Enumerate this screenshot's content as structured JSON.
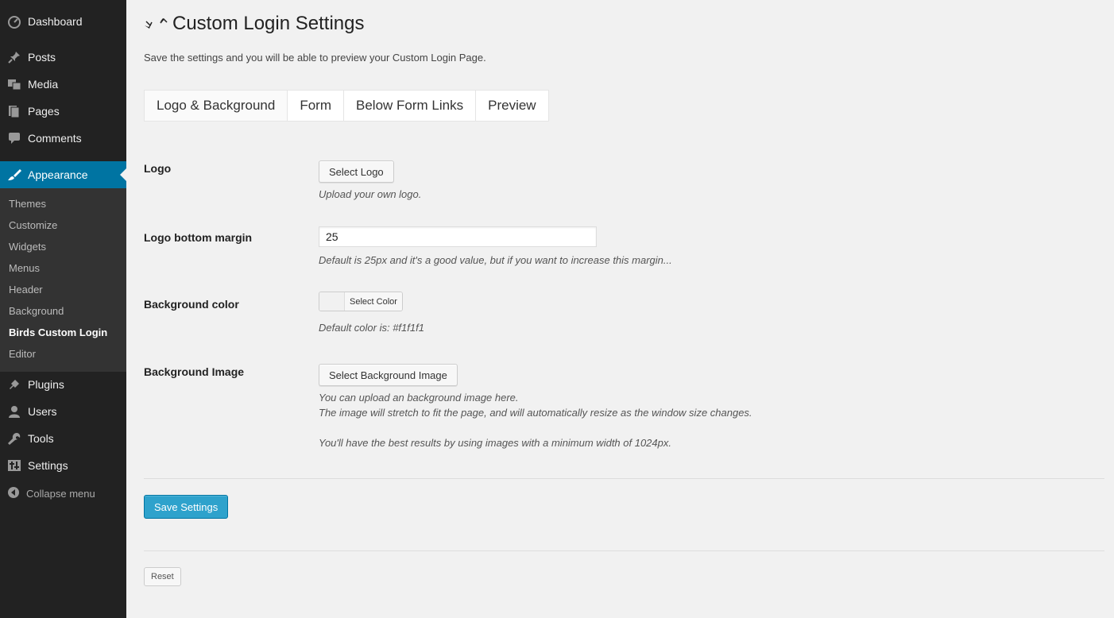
{
  "sidebar": {
    "menu": [
      {
        "label": "Dashboard",
        "icon": "dashboard-icon"
      },
      {
        "label": "Posts",
        "icon": "pin-icon"
      },
      {
        "label": "Media",
        "icon": "media-icon"
      },
      {
        "label": "Pages",
        "icon": "pages-icon"
      },
      {
        "label": "Comments",
        "icon": "comment-icon"
      },
      {
        "label": "Appearance",
        "icon": "paintbrush-icon"
      },
      {
        "label": "Plugins",
        "icon": "plug-icon"
      },
      {
        "label": "Users",
        "icon": "user-icon"
      },
      {
        "label": "Tools",
        "icon": "wrench-icon"
      },
      {
        "label": "Settings",
        "icon": "sliders-icon"
      }
    ],
    "submenu": [
      "Themes",
      "Customize",
      "Widgets",
      "Menus",
      "Header",
      "Background",
      "Birds Custom Login",
      "Editor"
    ],
    "current_submenu": "Birds Custom Login",
    "collapse_label": "Collapse menu",
    "colors": {
      "background": "#222222",
      "active": "#0074a2",
      "submenu_bg": "#333333"
    }
  },
  "page": {
    "title": "Custom Login Settings",
    "subtitle": "Save the settings and you will be able to preview your Custom Login Page.",
    "tabs": [
      "Logo & Background",
      "Form",
      "Below Form Links",
      "Preview"
    ],
    "active_tab": "Logo & Background"
  },
  "settings": {
    "logo": {
      "label": "Logo",
      "button": "Select Logo",
      "description": "Upload your own logo."
    },
    "logo_margin": {
      "label": "Logo bottom margin",
      "value": "25",
      "description": "Default is 25px and it's a good value, but if you want to increase this margin..."
    },
    "bg_color": {
      "label": "Background color",
      "button": "Select Color",
      "swatch": "#f1f1f1",
      "description": "Default color is: #f1f1f1"
    },
    "bg_image": {
      "label": "Background Image",
      "button": "Select Background Image",
      "description_1": "You can upload an background image here.",
      "description_2": "The image will stretch to fit the page, and will automatically resize as the window size changes.",
      "description_3": "You'll have the best results by using images with a minimum width of 1024px."
    }
  },
  "actions": {
    "save": "Save Settings",
    "reset": "Reset"
  }
}
